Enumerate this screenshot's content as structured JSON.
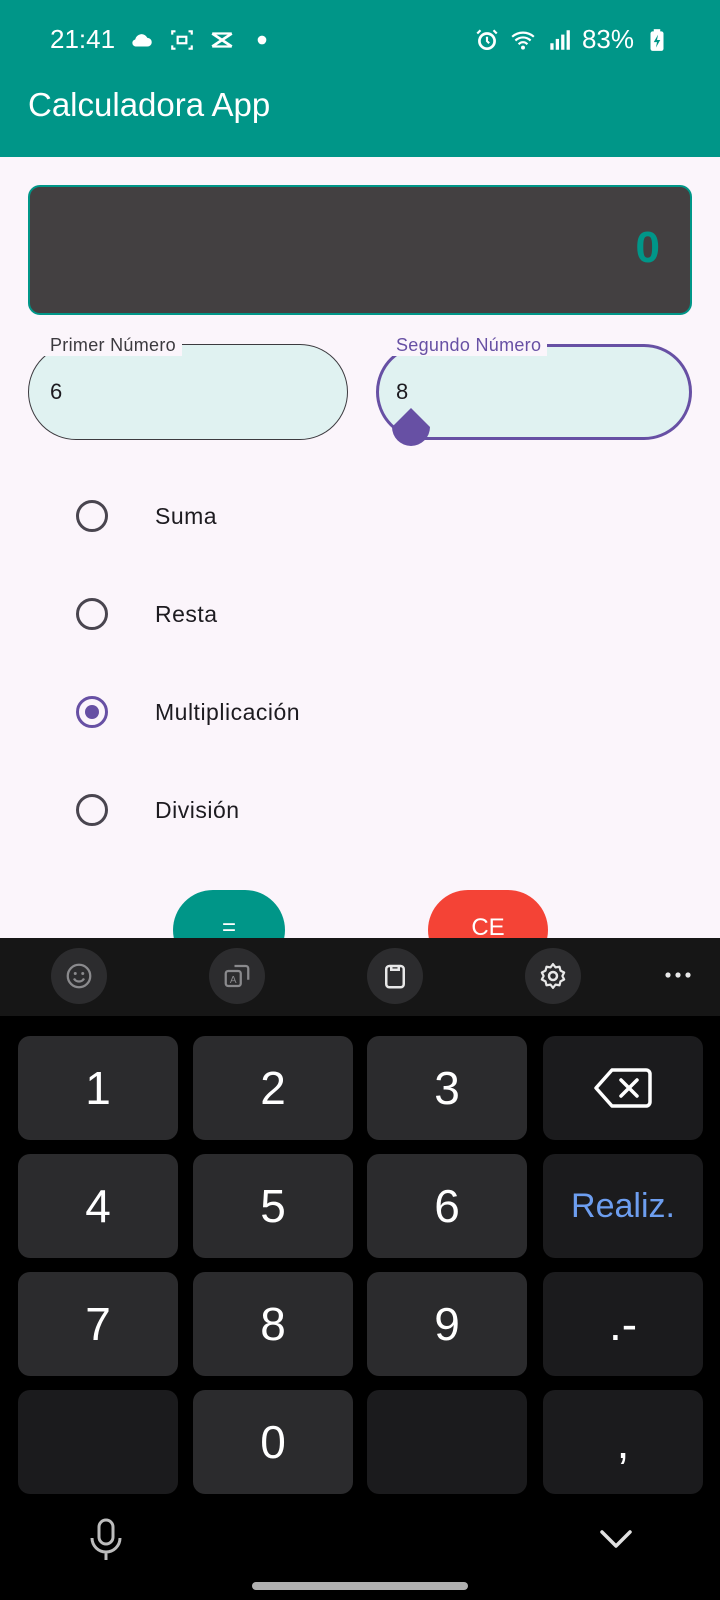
{
  "status_bar": {
    "time": "21:41",
    "battery": "83%",
    "icons": [
      "cloud-icon",
      "screen-record-icon",
      "capcut-icon",
      "dot-icon",
      "alarm-icon",
      "wifi-icon",
      "signal-icon",
      "battery-charging-icon"
    ]
  },
  "app": {
    "title": "Calculadora App"
  },
  "display": {
    "value": "0"
  },
  "fields": {
    "first": {
      "label": "Primer Número",
      "value": "6"
    },
    "second": {
      "label": "Segundo Número",
      "value": "8"
    }
  },
  "operations": [
    {
      "label": "Suma",
      "selected": false
    },
    {
      "label": "Resta",
      "selected": false
    },
    {
      "label": "Multiplicación",
      "selected": true
    },
    {
      "label": "División",
      "selected": false
    }
  ],
  "buttons": {
    "equal": "=",
    "clear": "CE"
  },
  "keyboard": {
    "toolbar_icons": [
      "emoji-icon",
      "translate-icon",
      "clipboard-icon",
      "settings-icon",
      "more-icon"
    ],
    "keys": {
      "k1": "1",
      "k2": "2",
      "k3": "3",
      "k4": "4",
      "k5": "5",
      "k6": "6",
      "k7": "7",
      "k8": "8",
      "k9": "9",
      "k0": "0",
      "action": "Realiz.",
      "dot_minus": ".-",
      "comma": ","
    }
  },
  "colors": {
    "primary": "#009688",
    "accent": "#6750a4",
    "danger": "#f44336",
    "display_bg": "#434041",
    "field_bg": "#e0f2f1",
    "keyboard_action": "#6d9ef0"
  }
}
